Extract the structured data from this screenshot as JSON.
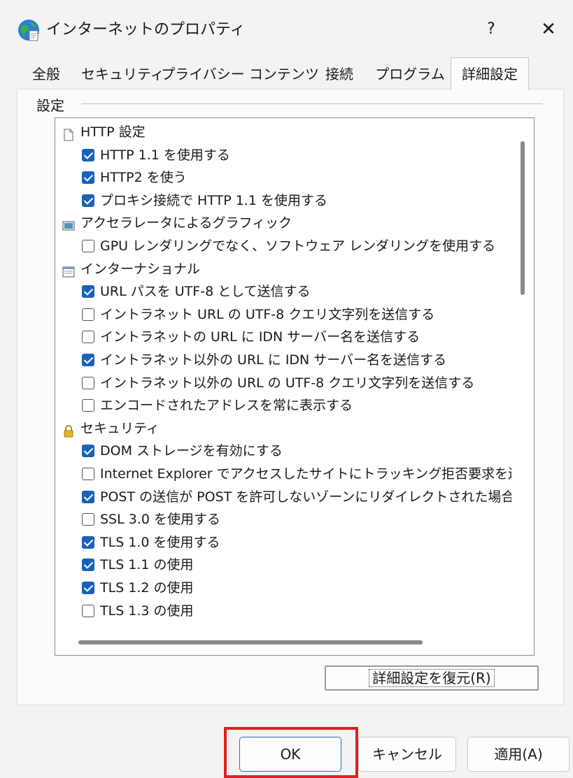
{
  "window": {
    "title": "インターネットのプロパティ",
    "help": "?",
    "close": "✕"
  },
  "tabs": [
    {
      "label": "全般"
    },
    {
      "label": "セキュリティ"
    },
    {
      "label": "プライバシー"
    },
    {
      "label": "コンテンツ"
    },
    {
      "label": "接続"
    },
    {
      "label": "プログラム"
    },
    {
      "label": "詳細設定"
    }
  ],
  "active_tab": "詳細設定",
  "settings": {
    "group_label": "設定",
    "items": [
      {
        "type": "category",
        "icon": "document-icon",
        "label": "HTTP 設定"
      },
      {
        "type": "option",
        "checked": true,
        "label": "HTTP 1.1 を使用する"
      },
      {
        "type": "option",
        "checked": true,
        "label": "HTTP2 を使う"
      },
      {
        "type": "option",
        "checked": true,
        "label": "プロキシ接続で HTTP 1.1 を使用する"
      },
      {
        "type": "category",
        "icon": "picture-icon",
        "label": "アクセラレータによるグラフィック"
      },
      {
        "type": "option",
        "checked": false,
        "label": "GPU レンダリングでなく、ソフトウェア レンダリングを使用する"
      },
      {
        "type": "category",
        "icon": "window-icon",
        "label": "インターナショナル"
      },
      {
        "type": "option",
        "checked": true,
        "label": "URL パスを UTF-8 として送信する"
      },
      {
        "type": "option",
        "checked": false,
        "label": "イントラネット URL の UTF-8 クエリ文字列を送信する"
      },
      {
        "type": "option",
        "checked": false,
        "label": "イントラネットの URL に IDN サーバー名を送信する"
      },
      {
        "type": "option",
        "checked": true,
        "label": "イントラネット以外の URL に IDN サーバー名を送信する"
      },
      {
        "type": "option",
        "checked": false,
        "label": "イントラネット以外の URL の UTF-8 クエリ文字列を送信する"
      },
      {
        "type": "option",
        "checked": false,
        "label": "エンコードされたアドレスを常に表示する"
      },
      {
        "type": "category",
        "icon": "lock-icon",
        "label": "セキュリティ"
      },
      {
        "type": "option",
        "checked": true,
        "label": "DOM ストレージを有効にする"
      },
      {
        "type": "option",
        "checked": false,
        "label": "Internet Explorer でアクセスしたサイトにトラッキング拒否要求を送"
      },
      {
        "type": "option",
        "checked": true,
        "label": "POST の送信が POST を許可しないゾーンにリダイレクトされた場合"
      },
      {
        "type": "option",
        "checked": false,
        "label": "SSL 3.0 を使用する"
      },
      {
        "type": "option",
        "checked": true,
        "label": "TLS 1.0 を使用する"
      },
      {
        "type": "option",
        "checked": true,
        "label": "TLS 1.1 の使用"
      },
      {
        "type": "option",
        "checked": true,
        "label": "TLS 1.2 の使用"
      },
      {
        "type": "option",
        "checked": false,
        "label": "TLS 1.3 の使用"
      }
    ]
  },
  "buttons": {
    "restore": "詳細設定を復元(R)",
    "ok": "OK",
    "cancel": "キャンセル",
    "apply": "適用(A)"
  },
  "colors": {
    "accent": "#1a62b8",
    "highlight": "#e02020"
  }
}
